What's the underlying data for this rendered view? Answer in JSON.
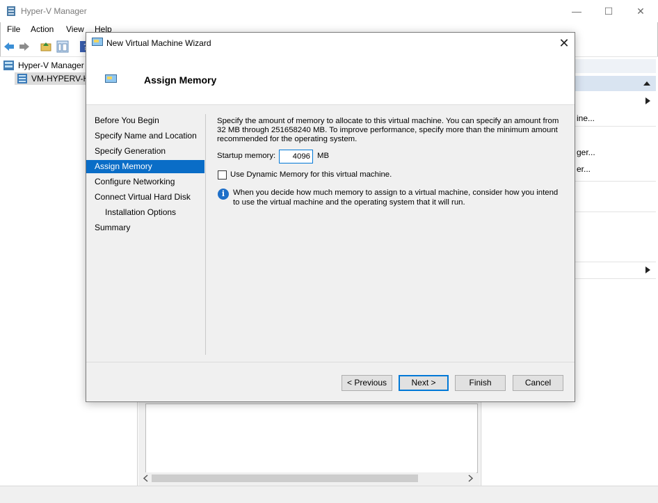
{
  "window": {
    "title": "Hyper-V Manager",
    "controls": {
      "minimize": "—",
      "maximize": "☐",
      "close": "✕"
    }
  },
  "menu": [
    "File",
    "Action",
    "View",
    "Help"
  ],
  "tree": {
    "root": "Hyper-V Manager",
    "server": "VM-HYPERV-H"
  },
  "actions": {
    "items": [
      "ine...",
      "ger...",
      "er..."
    ]
  },
  "dialog": {
    "title": "New Virtual Machine Wizard",
    "close_glyph": "✕",
    "heading": "Assign Memory",
    "steps": [
      "Before You Begin",
      "Specify Name and Location",
      "Specify Generation",
      "Assign Memory",
      "Configure Networking",
      "Connect Virtual Hard Disk",
      "Installation Options",
      "Summary"
    ],
    "active_step": "Assign Memory",
    "description": "Specify the amount of memory to allocate to this virtual machine. You can specify an amount from 32 MB through 251658240 MB. To improve performance, specify more than the minimum amount recommended for the operating system.",
    "startup_memory_label": "Startup memory:",
    "startup_memory_value": "4096",
    "startup_memory_unit": "MB",
    "dynamic_memory_label": "Use Dynamic Memory for this virtual machine.",
    "dynamic_memory_checked": false,
    "info_text": "When you decide how much memory to assign to a virtual machine, consider how you intend to use the virtual machine and the operating system that it will run.",
    "buttons": {
      "previous": "< Previous",
      "next": "Next >",
      "finish": "Finish",
      "cancel": "Cancel"
    }
  },
  "colors": {
    "accent": "#0078d7",
    "selection": "#0a6dc7",
    "info": "#1e6fc8",
    "actions_header": "#d9e4f1"
  }
}
